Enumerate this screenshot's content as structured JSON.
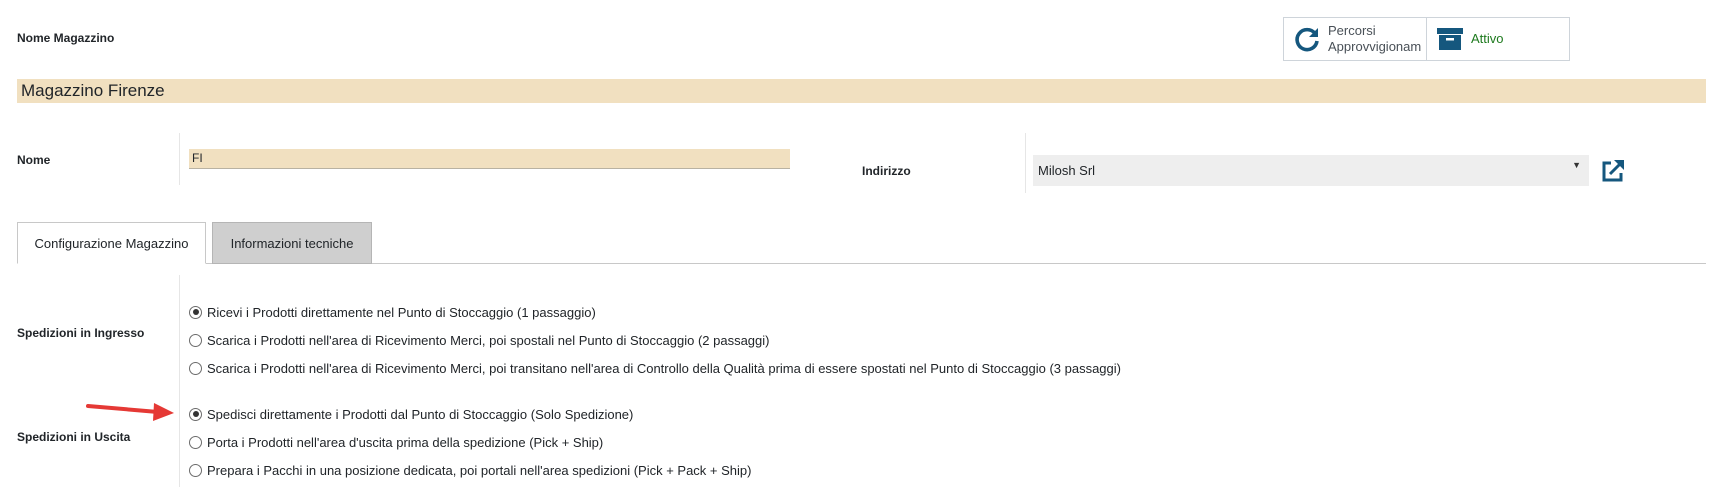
{
  "form": {
    "heading_label": "Nome Magazzino",
    "warehouse_name": "Magazzino Firenze",
    "nome_label": "Nome",
    "nome_value": "FI",
    "indirizzo_label": "Indirizzo",
    "indirizzo_value": "Milosh Srl"
  },
  "smart_buttons": {
    "routes_line1": "Percorsi",
    "routes_line2": "Approvvigionam",
    "active_label": "Attivo"
  },
  "tabs": [
    {
      "label": "Configurazione Magazzino",
      "active": true
    },
    {
      "label": "Informazioni tecniche",
      "active": false
    }
  ],
  "incoming": {
    "label": "Spedizioni in Ingresso",
    "options": [
      {
        "label": "Ricevi i Prodotti direttamente nel Punto di Stoccaggio (1 passaggio)",
        "selected": true
      },
      {
        "label": "Scarica i Prodotti nell'area di Ricevimento Merci, poi spostali nel Punto di Stoccaggio (2 passaggi)",
        "selected": false
      },
      {
        "label": "Scarica i Prodotti nell'area di Ricevimento Merci, poi transitano nell'area di Controllo della Qualità prima di essere spostati nel Punto di Stoccaggio (3 passaggi)",
        "selected": false
      }
    ]
  },
  "outgoing": {
    "label": "Spedizioni in Uscita",
    "options": [
      {
        "label": "Spedisci direttamente i Prodotti dal Punto di Stoccaggio (Solo Spedizione)",
        "selected": true
      },
      {
        "label": "Porta i Prodotti nell'area d'uscita prima della spedizione (Pick + Ship)",
        "selected": false
      },
      {
        "label": "Prepara i Pacchi in una posizione dedicata, poi portali nell'area spedizioni (Pick + Pack + Ship)",
        "selected": false
      }
    ]
  },
  "colors": {
    "highlight_field": "#f1e0c0",
    "icon_blue": "#15577e",
    "active_green": "#1e7a1e",
    "annotation_arrow": "#e53935"
  },
  "icons": {
    "routes": "refresh-icon",
    "active": "archive-icon",
    "external": "external-link-icon"
  }
}
